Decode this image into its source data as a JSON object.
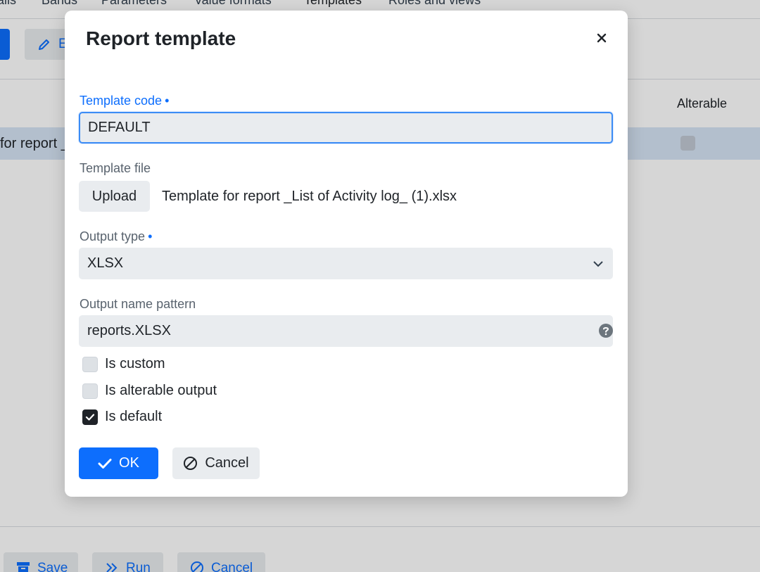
{
  "background": {
    "tabs": [
      "ails",
      "Bands",
      "Parameters",
      "Value formats",
      "Templates",
      "Roles and views"
    ],
    "active_tab": "Templates",
    "edit_button_label": "E",
    "table": {
      "column_alterable": "Alterable",
      "row_text": "for report _",
      "row_alterable_checked": false
    },
    "footer": {
      "save_label": "Save",
      "run_label": "Run",
      "cancel_label": "Cancel"
    }
  },
  "dialog": {
    "title": "Report template",
    "close_icon": "close-icon",
    "template_code": {
      "label": "Template code",
      "required_marker": "•",
      "value": "DEFAULT"
    },
    "template_file": {
      "label": "Template file",
      "upload_label": "Upload",
      "file_name": "Template for report _List of Activity log_ (1).xlsx"
    },
    "output_type": {
      "label": "Output type",
      "required_marker": "•",
      "value": "XLSX",
      "icon": "chevron-down-icon"
    },
    "output_name_pattern": {
      "label": "Output name pattern",
      "value": "reports.XLSX",
      "icon": "help-icon"
    },
    "checkboxes": [
      {
        "label": "Is custom",
        "checked": false
      },
      {
        "label": "Is alterable output",
        "checked": false
      },
      {
        "label": "Is default",
        "checked": true
      }
    ],
    "ok_label": "OK",
    "cancel_label": "Cancel"
  },
  "colors": {
    "accent": "#0d6efd",
    "input_bg": "#e9ecef",
    "selected_row": "#d6e4f5"
  }
}
